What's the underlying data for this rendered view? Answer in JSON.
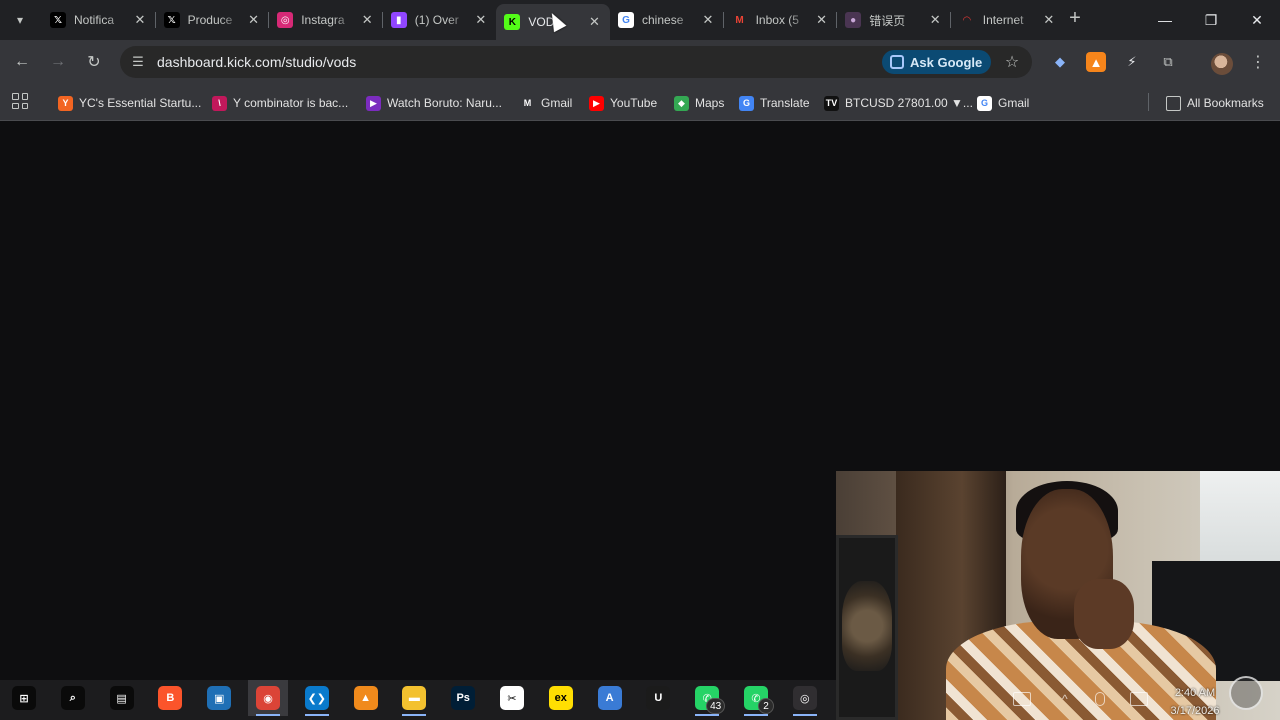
{
  "tabs": [
    {
      "label": "Notifica",
      "icon": "x-icon",
      "active": false
    },
    {
      "label": "Produce",
      "icon": "x-icon",
      "active": false
    },
    {
      "label": "Instagra",
      "icon": "instagram-icon",
      "active": false
    },
    {
      "label": "(1) Over",
      "icon": "twitch-icon",
      "active": false
    },
    {
      "label": "VOD",
      "icon": "kick-icon",
      "active": true
    },
    {
      "label": "chinese",
      "icon": "google-icon",
      "active": false
    },
    {
      "label": "Inbox (5",
      "icon": "gmail-icon",
      "active": false
    },
    {
      "label": "错误页",
      "icon": "error-page-icon",
      "active": false
    },
    {
      "label": "Internet",
      "icon": "internet-icon",
      "active": false
    }
  ],
  "toolbar": {
    "url": "dashboard.kick.com/studio/vods",
    "ask_google": "Ask Google"
  },
  "bookmarks": [
    {
      "label": "YC's Essential Startu...",
      "icon": "yc-icon",
      "color": "#f26522",
      "glyph": "Y"
    },
    {
      "label": "Y combinator is bac...",
      "icon": "slides-icon",
      "color": "#c2185b",
      "glyph": "\\"
    },
    {
      "label": "Watch Boruto: Naru...",
      "icon": "play-triangle-icon",
      "color": "#7b2cbf",
      "glyph": "▶"
    },
    {
      "label": "Gmail",
      "icon": "gmail-icon",
      "color": "#35363a",
      "glyph": "M"
    },
    {
      "label": "YouTube",
      "icon": "youtube-icon",
      "color": "#ff0000",
      "glyph": "▶"
    },
    {
      "label": "Maps",
      "icon": "maps-icon",
      "color": "#34a853",
      "glyph": "◆"
    },
    {
      "label": "Translate",
      "icon": "translate-icon",
      "color": "#4285f4",
      "glyph": "G"
    },
    {
      "label": "BTCUSD 27801.00 ▼...",
      "icon": "tradingview-icon",
      "color": "#111111",
      "glyph": "TV"
    },
    {
      "label": "Gmail",
      "icon": "google-icon",
      "color": "#ffffff",
      "glyph": "G"
    }
  ],
  "all_bookmarks": "All Bookmarks",
  "taskbar": {
    "items": [
      {
        "name": "start-icon",
        "color": "#0a0a0a",
        "glyph": "⊞"
      },
      {
        "name": "search-icon",
        "color": "#0a0a0a",
        "glyph": "⌕"
      },
      {
        "name": "task-view-icon",
        "color": "#0a0a0a",
        "glyph": "▤"
      },
      {
        "name": "brave-icon",
        "color": "#fb542b",
        "glyph": "B"
      },
      {
        "name": "virtualbox-icon",
        "color": "#1f6fb5",
        "glyph": "▣"
      },
      {
        "name": "chrome-icon",
        "color": "#db4437",
        "glyph": "◉"
      },
      {
        "name": "vscode-icon",
        "color": "#0a7acc",
        "glyph": "❮❯"
      },
      {
        "name": "vlc-icon",
        "color": "#f08a1c",
        "glyph": "▲"
      },
      {
        "name": "file-explorer-icon",
        "color": "#f3c12f",
        "glyph": "▬"
      },
      {
        "name": "photoshop-icon",
        "color": "#001e36",
        "glyph": "Ps"
      },
      {
        "name": "capcut-icon",
        "color": "#ffffff",
        "glyph": "✂"
      },
      {
        "name": "exness-icon",
        "color": "#ffde02",
        "glyph": "ex"
      },
      {
        "name": "artstudio-icon",
        "color": "#3a7bd5",
        "glyph": "A"
      },
      {
        "name": "unreal-icon",
        "color": "#1b1b1b",
        "glyph": "U"
      },
      {
        "name": "whatsapp-icon",
        "color": "#25d366",
        "glyph": "✆",
        "badge": "43"
      },
      {
        "name": "whatsapp-business-icon",
        "color": "#25d366",
        "glyph": "✆",
        "badge": "2"
      },
      {
        "name": "obs-icon",
        "color": "#302e31",
        "glyph": "◎"
      }
    ]
  },
  "clock": {
    "time": "2:40 AM",
    "date": "3/17/2026"
  }
}
